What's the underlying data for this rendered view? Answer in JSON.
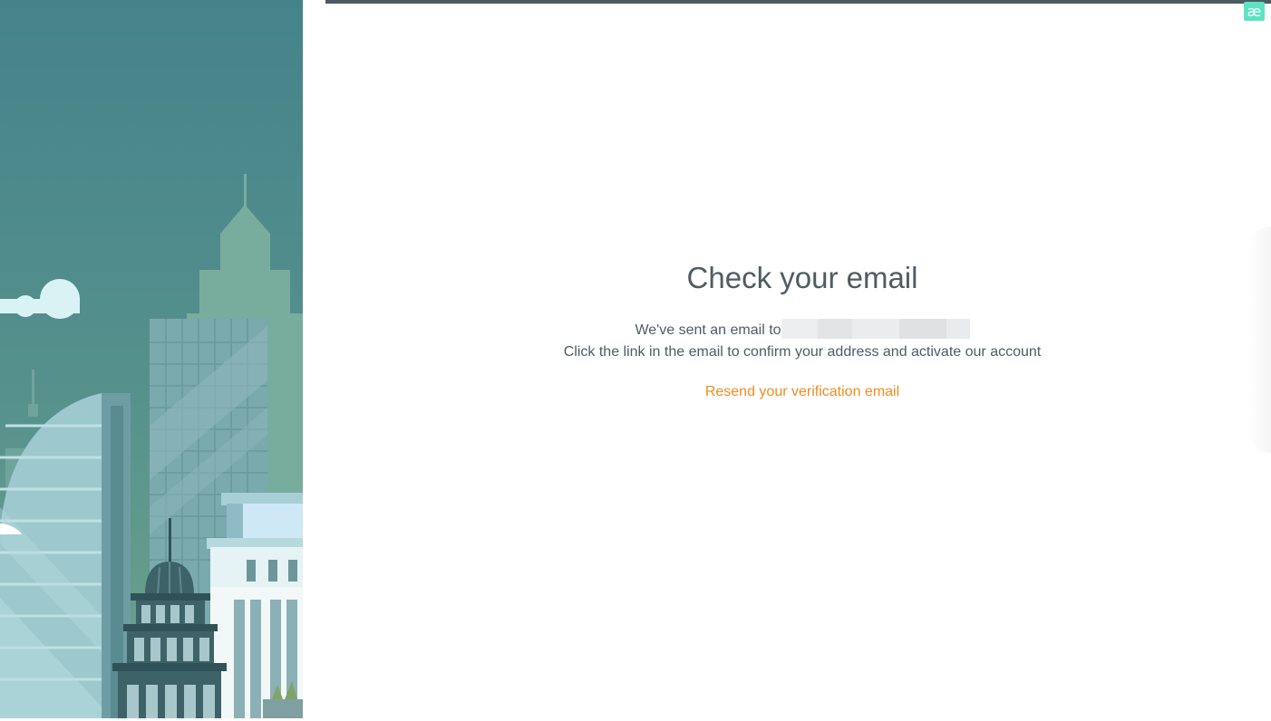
{
  "brand": {
    "badge_text": "æ",
    "badge_color": "#5de3c2"
  },
  "verification": {
    "title": "Check your email",
    "sent_prefix": "We've sent an email to",
    "instructions": "Click the link in the email to confirm your address and activate our account",
    "resend_label": "Resend your verification email"
  },
  "colors": {
    "text": "#4f5c63",
    "link": "#f08c21",
    "top_bar": "#4c5b62",
    "sky_top": "#45838b",
    "sky_bottom": "#6a9e8d"
  }
}
